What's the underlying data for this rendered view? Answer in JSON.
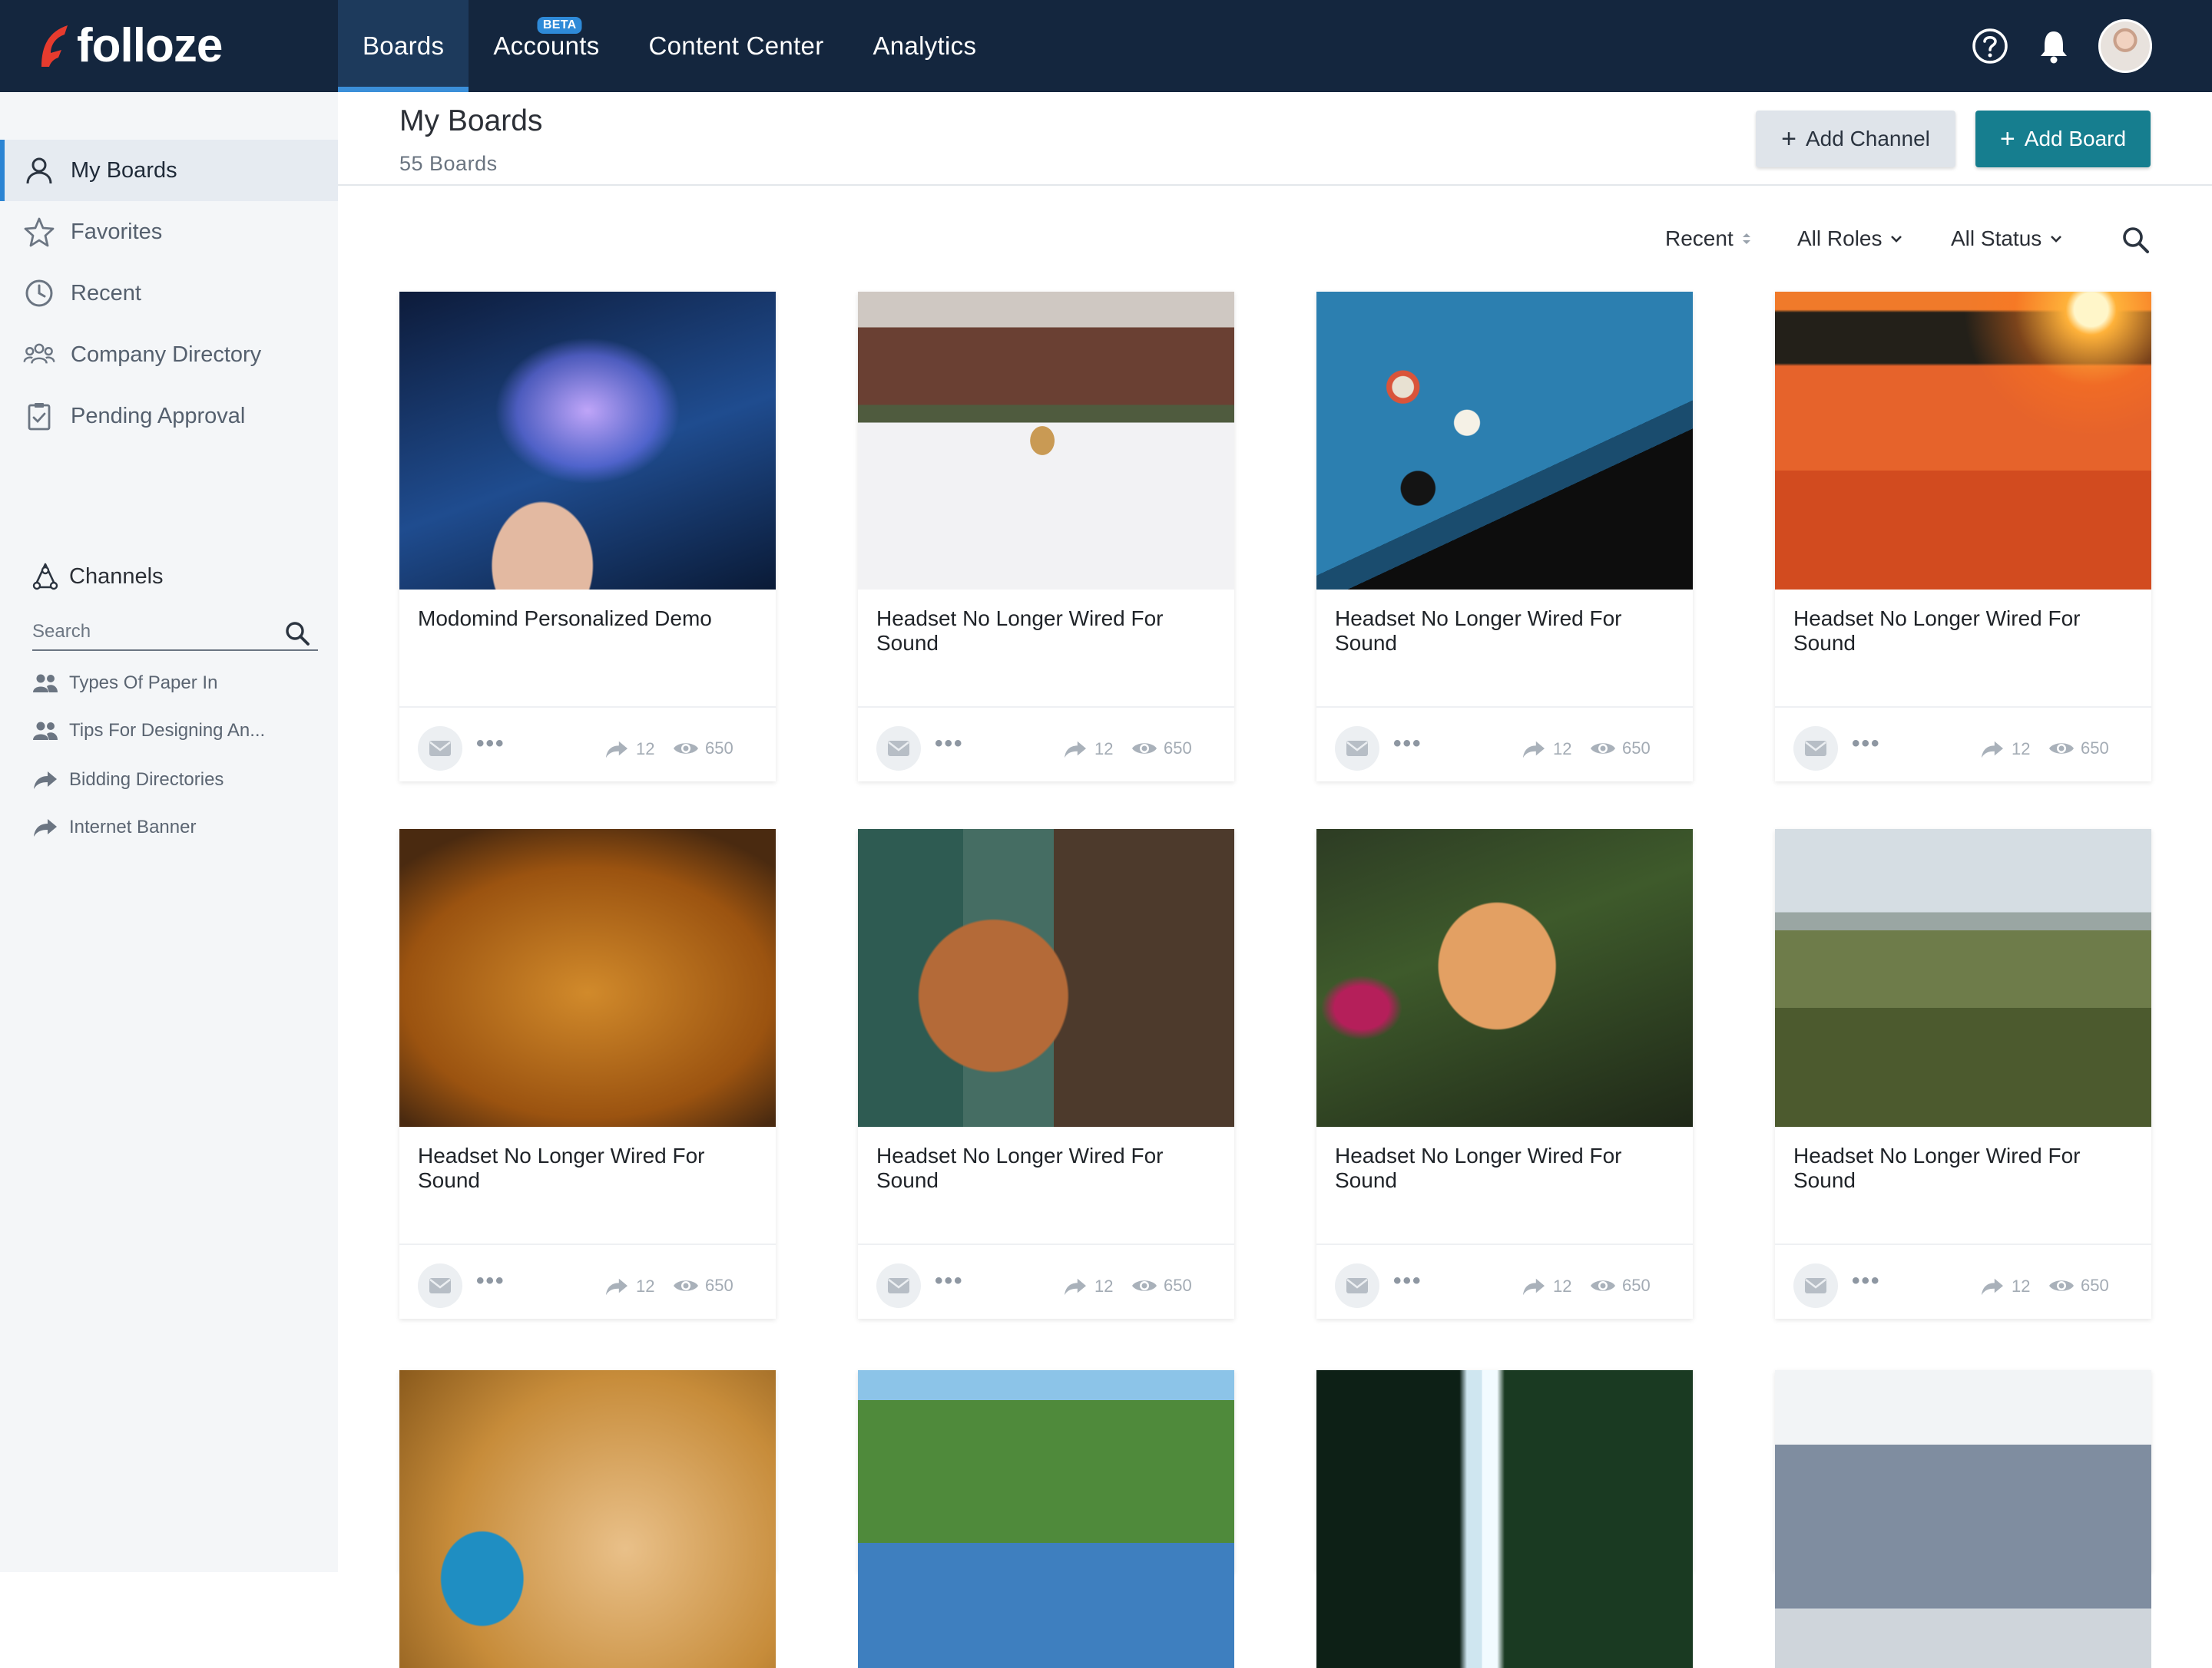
{
  "app": {
    "logo_text": "folloze",
    "brand_color": "#e63b2e",
    "nav": [
      {
        "label": "Boards",
        "active": true
      },
      {
        "label": "Accounts",
        "badge": "BETA"
      },
      {
        "label": "Content Center"
      },
      {
        "label": "Analytics"
      }
    ],
    "icons": [
      "help-icon",
      "bell-icon",
      "avatar"
    ]
  },
  "sidebar": {
    "items": [
      {
        "label": "My Boards",
        "icon": "user-icon",
        "active": true
      },
      {
        "label": "Favorites",
        "icon": "star-icon"
      },
      {
        "label": "Recent",
        "icon": "clock-icon"
      },
      {
        "label": "Company Directory",
        "icon": "group-icon"
      },
      {
        "label": "Pending Approval",
        "icon": "clipboard-check-icon"
      }
    ],
    "channels_title": "Channels",
    "search_placeholder": "Search",
    "channels": [
      {
        "label": "Types Of Paper In",
        "icon": "people-icon"
      },
      {
        "label": "Tips For Designing An...",
        "icon": "people-icon"
      },
      {
        "label": "Bidding Directories",
        "icon": "share-arrow-icon"
      },
      {
        "label": "Internet Banner",
        "icon": "share-arrow-icon"
      }
    ]
  },
  "header": {
    "title": "My Boards",
    "subtitle": "55 Boards",
    "add_channel": "Add Channel",
    "add_board": "Add Board",
    "accent_color": "#167e8f"
  },
  "filters": {
    "sort": "Recent",
    "roles": "All Roles",
    "status": "All Status"
  },
  "cards": [
    {
      "title": "Modomind Personalized Demo",
      "shares": "12",
      "views": "650"
    },
    {
      "title": "Headset No Longer Wired For Sound",
      "shares": "12",
      "views": "650"
    },
    {
      "title": "Headset No Longer Wired For Sound",
      "shares": "12",
      "views": "650"
    },
    {
      "title": "Headset No Longer Wired For Sound",
      "shares": "12",
      "views": "650"
    },
    {
      "title": "Headset No Longer Wired For Sound",
      "shares": "12",
      "views": "650"
    },
    {
      "title": "Headset No Longer Wired For Sound",
      "shares": "12",
      "views": "650"
    },
    {
      "title": "Headset No Longer Wired For Sound",
      "shares": "12",
      "views": "650"
    },
    {
      "title": "Headset No Longer Wired For Sound",
      "shares": "12",
      "views": "650"
    },
    {
      "title": "",
      "shares": "",
      "views": ""
    },
    {
      "title": "",
      "shares": "",
      "views": ""
    },
    {
      "title": "",
      "shares": "",
      "views": ""
    },
    {
      "title": "",
      "shares": "",
      "views": ""
    }
  ]
}
